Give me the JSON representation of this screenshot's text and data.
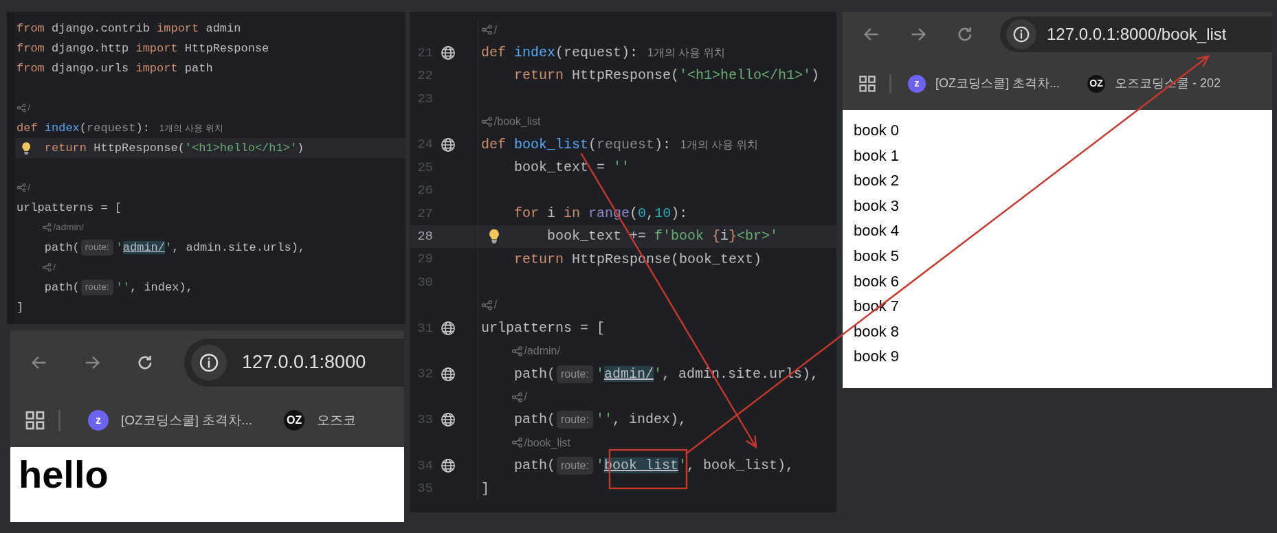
{
  "editor_left": {
    "lines": [
      {
        "kind": "code",
        "segments": [
          {
            "kind": "code",
            "tokens": [
              {
                "kind": "kw",
                "text": "from "
              },
              {
                "kind": "plain",
                "text": "django.contrib "
              },
              {
                "kind": "kw",
                "text": "import "
              },
              {
                "kind": "plain",
                "text": "admin"
              }
            ]
          }
        ]
      },
      {
        "kind": "code",
        "segments": [
          {
            "kind": "code",
            "tokens": [
              {
                "kind": "kw",
                "text": "from "
              },
              {
                "kind": "plain",
                "text": "django.http "
              },
              {
                "kind": "kw",
                "text": "import "
              },
              {
                "kind": "plain",
                "text": "HttpResponse"
              }
            ]
          }
        ]
      },
      {
        "kind": "code",
        "segments": [
          {
            "kind": "code",
            "tokens": [
              {
                "kind": "kw",
                "text": "from "
              },
              {
                "kind": "plain",
                "text": "django.urls "
              },
              {
                "kind": "kw",
                "text": "import "
              },
              {
                "kind": "plain",
                "text": "path"
              }
            ]
          }
        ]
      },
      {
        "kind": "blank"
      },
      {
        "kind": "route",
        "indented": false,
        "text": "/"
      },
      {
        "kind": "code",
        "segments": [
          {
            "kind": "code",
            "tokens": [
              {
                "kind": "kw",
                "text": "def "
              },
              {
                "kind": "func",
                "text": "index"
              },
              {
                "kind": "plain",
                "text": "("
              },
              {
                "kind": "param",
                "text": "request"
              },
              {
                "kind": "plain",
                "text": "):"
              }
            ]
          },
          {
            "kind": "usage",
            "text": "1개의 사용 위치"
          }
        ]
      },
      {
        "kind": "code",
        "current": true,
        "bulb": true,
        "segments": [
          {
            "kind": "code",
            "tokens": [
              {
                "kind": "kw",
                "text": "    return "
              },
              {
                "kind": "plain",
                "text": "HttpResponse("
              },
              {
                "kind": "str",
                "text": "'<h1>hello</h1>'"
              },
              {
                "kind": "plain",
                "text": ")"
              }
            ]
          }
        ]
      },
      {
        "kind": "blank"
      },
      {
        "kind": "route",
        "indented": false,
        "text": "/"
      },
      {
        "kind": "code",
        "segments": [
          {
            "kind": "code",
            "tokens": [
              {
                "kind": "plain",
                "text": "urlpatterns = ["
              }
            ]
          }
        ]
      },
      {
        "kind": "route",
        "indented": true,
        "text": "/admin/"
      },
      {
        "kind": "code",
        "segments": [
          {
            "kind": "code",
            "tokens": [
              {
                "kind": "plain",
                "text": "    path("
              }
            ]
          },
          {
            "kind": "hint",
            "text": "route:"
          },
          {
            "kind": "code",
            "tokens": [
              {
                "kind": "str",
                "text": "'"
              },
              {
                "kind": "hl",
                "text": "admin/"
              },
              {
                "kind": "str",
                "text": "'"
              },
              {
                "kind": "plain",
                "text": ", admin.site.urls),"
              }
            ]
          }
        ]
      },
      {
        "kind": "route",
        "indented": true,
        "text": "/"
      },
      {
        "kind": "code",
        "segments": [
          {
            "kind": "code",
            "tokens": [
              {
                "kind": "plain",
                "text": "    path("
              }
            ]
          },
          {
            "kind": "hint",
            "text": "route:"
          },
          {
            "kind": "code",
            "tokens": [
              {
                "kind": "str",
                "text": "''"
              },
              {
                "kind": "plain",
                "text": ", index),"
              }
            ]
          }
        ]
      },
      {
        "kind": "code",
        "segments": [
          {
            "kind": "code",
            "tokens": [
              {
                "kind": "plain",
                "text": "]"
              }
            ]
          }
        ]
      }
    ]
  },
  "browser_left": {
    "nav": [
      {
        "kind": "back",
        "disabled": true
      },
      {
        "kind": "forward",
        "disabled": true
      },
      {
        "kind": "reload",
        "disabled": false
      }
    ],
    "url": "127.0.0.1:8000",
    "bookmarks": [
      {
        "kind": "z",
        "icon_text": "z",
        "label": "[OZ코딩스쿨] 초격차..."
      },
      {
        "kind": "oz",
        "icon_text": "OZ",
        "label": "오즈코"
      }
    ],
    "page": {
      "kind": "heading",
      "text": "hello"
    }
  },
  "editor_middle": {
    "lines": [
      {
        "kind": "route",
        "indented": false,
        "text": "/"
      },
      {
        "kind": "code",
        "number": "21",
        "globe": true,
        "segments": [
          {
            "kind": "code",
            "tokens": [
              {
                "kind": "kw",
                "text": "def "
              },
              {
                "kind": "func",
                "text": "index"
              },
              {
                "kind": "plain",
                "text": "(request):"
              }
            ]
          },
          {
            "kind": "usage",
            "text": "1개의 사용 위치"
          }
        ]
      },
      {
        "kind": "code",
        "number": "22",
        "segments": [
          {
            "kind": "code",
            "tokens": [
              {
                "kind": "kw",
                "text": "    return "
              },
              {
                "kind": "plain",
                "text": "HttpResponse("
              },
              {
                "kind": "str",
                "text": "'<h1>hello</h1>'"
              },
              {
                "kind": "plain",
                "text": ")"
              }
            ]
          }
        ]
      },
      {
        "kind": "blank",
        "number": "23"
      },
      {
        "kind": "route",
        "indented": false,
        "text": "/book_list"
      },
      {
        "kind": "code",
        "number": "24",
        "globe": true,
        "segments": [
          {
            "kind": "code",
            "tokens": [
              {
                "kind": "kw",
                "text": "def "
              },
              {
                "kind": "func",
                "text": "book_list"
              },
              {
                "kind": "plain",
                "text": "("
              },
              {
                "kind": "param",
                "text": "request"
              },
              {
                "kind": "plain",
                "text": "):"
              }
            ]
          },
          {
            "kind": "usage",
            "text": "1개의 사용 위치"
          }
        ]
      },
      {
        "kind": "code",
        "number": "25",
        "segments": [
          {
            "kind": "code",
            "tokens": [
              {
                "kind": "plain",
                "text": "    book_text = "
              },
              {
                "kind": "str",
                "text": "''"
              }
            ]
          }
        ]
      },
      {
        "kind": "blank",
        "number": "26"
      },
      {
        "kind": "code",
        "number": "27",
        "segments": [
          {
            "kind": "code",
            "tokens": [
              {
                "kind": "kw",
                "text": "    for "
              },
              {
                "kind": "plain",
                "text": "i "
              },
              {
                "kind": "kw",
                "text": "in "
              },
              {
                "kind": "builtin",
                "text": "range"
              },
              {
                "kind": "plain",
                "text": "("
              },
              {
                "kind": "num",
                "text": "0"
              },
              {
                "kind": "plain",
                "text": ","
              },
              {
                "kind": "num",
                "text": "10"
              },
              {
                "kind": "plain",
                "text": "):"
              }
            ]
          }
        ]
      },
      {
        "kind": "code",
        "number": "28",
        "current": true,
        "bulb": true,
        "segments": [
          {
            "kind": "code",
            "tokens": [
              {
                "kind": "plain",
                "text": "        book_text += "
              },
              {
                "kind": "str",
                "text": "f'book "
              },
              {
                "kind": "brace",
                "text": "{"
              },
              {
                "kind": "plain",
                "text": "i"
              },
              {
                "kind": "brace",
                "text": "}"
              },
              {
                "kind": "str",
                "text": "<br>'"
              }
            ]
          }
        ]
      },
      {
        "kind": "code",
        "number": "29",
        "segments": [
          {
            "kind": "code",
            "tokens": [
              {
                "kind": "kw",
                "text": "    return "
              },
              {
                "kind": "plain",
                "text": "HttpResponse(book_text)"
              }
            ]
          }
        ]
      },
      {
        "kind": "blank",
        "number": "30"
      },
      {
        "kind": "route",
        "indented": false,
        "text": "/"
      },
      {
        "kind": "code",
        "number": "31",
        "globe": true,
        "segments": [
          {
            "kind": "code",
            "tokens": [
              {
                "kind": "plain",
                "text": "urlpatterns = ["
              }
            ]
          }
        ]
      },
      {
        "kind": "route",
        "indented": true,
        "text": "/admin/"
      },
      {
        "kind": "code",
        "number": "32",
        "globe": true,
        "segments": [
          {
            "kind": "code",
            "tokens": [
              {
                "kind": "plain",
                "text": "    path("
              }
            ]
          },
          {
            "kind": "hint",
            "text": "route:"
          },
          {
            "kind": "code",
            "tokens": [
              {
                "kind": "str",
                "text": "'"
              },
              {
                "kind": "hl",
                "text": "admin/"
              },
              {
                "kind": "str",
                "text": "'"
              },
              {
                "kind": "plain",
                "text": ", admin.site.urls),"
              }
            ]
          }
        ]
      },
      {
        "kind": "route",
        "indented": true,
        "text": "/"
      },
      {
        "kind": "code",
        "number": "33",
        "globe": true,
        "segments": [
          {
            "kind": "code",
            "tokens": [
              {
                "kind": "plain",
                "text": "    path("
              }
            ]
          },
          {
            "kind": "hint",
            "text": "route:"
          },
          {
            "kind": "code",
            "tokens": [
              {
                "kind": "str",
                "text": "''"
              },
              {
                "kind": "plain",
                "text": ", index),"
              }
            ]
          }
        ]
      },
      {
        "kind": "route",
        "indented": true,
        "text": "/book_list"
      },
      {
        "kind": "code",
        "number": "34",
        "globe": true,
        "segments": [
          {
            "kind": "code",
            "tokens": [
              {
                "kind": "plain",
                "text": "    path("
              }
            ]
          },
          {
            "kind": "hint",
            "text": "route:"
          },
          {
            "kind": "code",
            "tokens": [
              {
                "kind": "str",
                "text": "'"
              },
              {
                "kind": "hl",
                "text": "book_list"
              },
              {
                "kind": "str",
                "text": "'"
              },
              {
                "kind": "plain",
                "text": ", book_list),"
              }
            ]
          }
        ]
      },
      {
        "kind": "code",
        "number": "35",
        "segments": [
          {
            "kind": "code",
            "tokens": [
              {
                "kind": "plain",
                "text": "]"
              }
            ]
          }
        ]
      }
    ]
  },
  "browser_right": {
    "nav": [
      {
        "kind": "back",
        "disabled": true
      },
      {
        "kind": "forward",
        "disabled": true
      },
      {
        "kind": "reload",
        "disabled": true
      }
    ],
    "url": "127.0.0.1:8000/book_list",
    "bookmarks": [
      {
        "kind": "z",
        "icon_text": "z",
        "label": "[OZ코딩스쿨] 초격차..."
      },
      {
        "kind": "oz",
        "icon_text": "OZ",
        "label": "오즈코딩스쿨 - 202"
      }
    ],
    "page": {
      "kind": "lines",
      "lines": [
        "book 0",
        "book 1",
        "book 2",
        "book 3",
        "book 4",
        "book 5",
        "book 6",
        "book 7",
        "book 8",
        "book 9"
      ]
    }
  },
  "annotations": [
    {
      "kind": "arrow"
    },
    {
      "kind": "frame"
    },
    {
      "kind": "arrow"
    }
  ]
}
